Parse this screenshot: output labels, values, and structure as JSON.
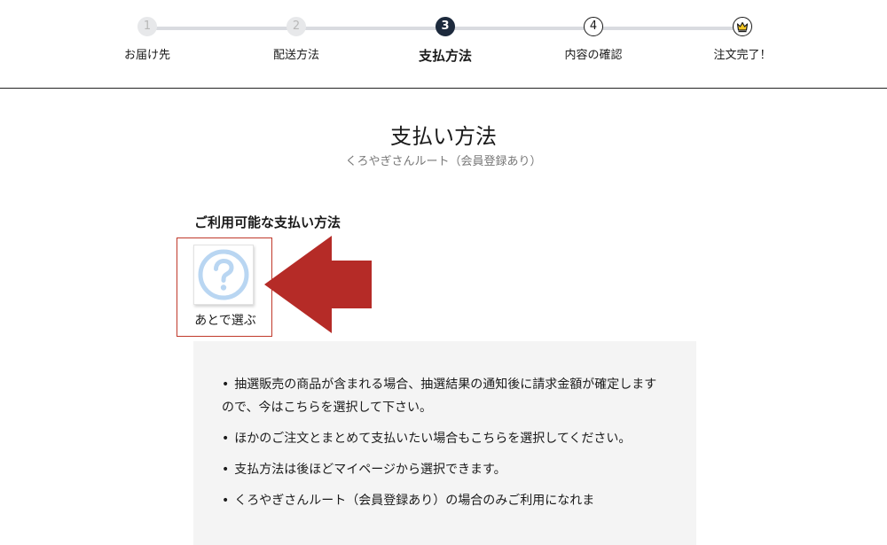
{
  "stepper": {
    "steps": [
      {
        "number": "1",
        "label": "お届け先",
        "state": "done"
      },
      {
        "number": "2",
        "label": "配送方法",
        "state": "done"
      },
      {
        "number": "3",
        "label": "支払方法",
        "state": "current"
      },
      {
        "number": "4",
        "label": "内容の確認",
        "state": "todo"
      },
      {
        "icon": "crown-icon",
        "label": "注文完了！",
        "state": "todo"
      }
    ]
  },
  "page": {
    "title": "支払い方法",
    "subtitle": "くろやぎさんルート（会員登録あり）"
  },
  "payment_section": {
    "heading": "ご利用可能な支払い方法",
    "methods": [
      {
        "label": "あとで選ぶ",
        "icon": "question-circle-icon",
        "selected": true
      }
    ]
  },
  "notes": {
    "bullet": "•",
    "items": [
      "抽選販売の商品が含まれる場合、抽選結果の通知後に請求金額が確定しますので、今はこちらを選択して下さい。",
      "ほかのご注文とまとめて支払いたい場合もこちらを選択してください。",
      "支払方法は後ほどマイページから選択できます。",
      "くろやぎさんルート（会員登録あり）の場合のみご利用になれま"
    ]
  },
  "colors": {
    "current_step": "#1d2a3d",
    "done_step": "#e7e8ea",
    "highlight_border": "#c0392b",
    "arrow": "#b52b27",
    "question_icon": "#b9d6f2",
    "notes_background": "#f4f4f4"
  }
}
